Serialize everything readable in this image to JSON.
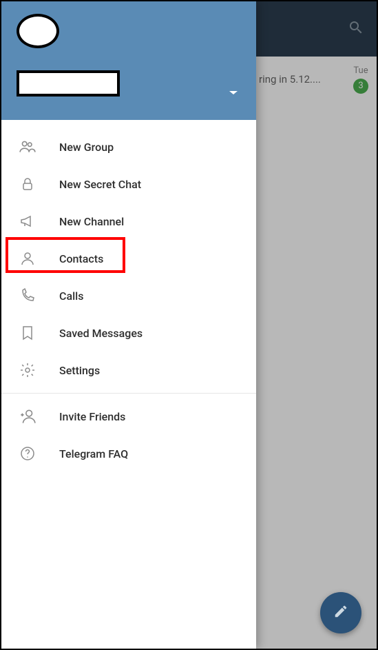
{
  "topbar": {},
  "chat_preview": {
    "text": "ring in 5.12....",
    "date": "Tue",
    "badge": "3"
  },
  "drawer": {
    "menu": [
      {
        "label": "New Group"
      },
      {
        "label": "New Secret Chat"
      },
      {
        "label": "New Channel"
      },
      {
        "label": "Contacts"
      },
      {
        "label": "Calls"
      },
      {
        "label": "Saved Messages"
      },
      {
        "label": "Settings"
      }
    ],
    "footer": [
      {
        "label": "Invite Friends"
      },
      {
        "label": "Telegram FAQ"
      }
    ]
  }
}
